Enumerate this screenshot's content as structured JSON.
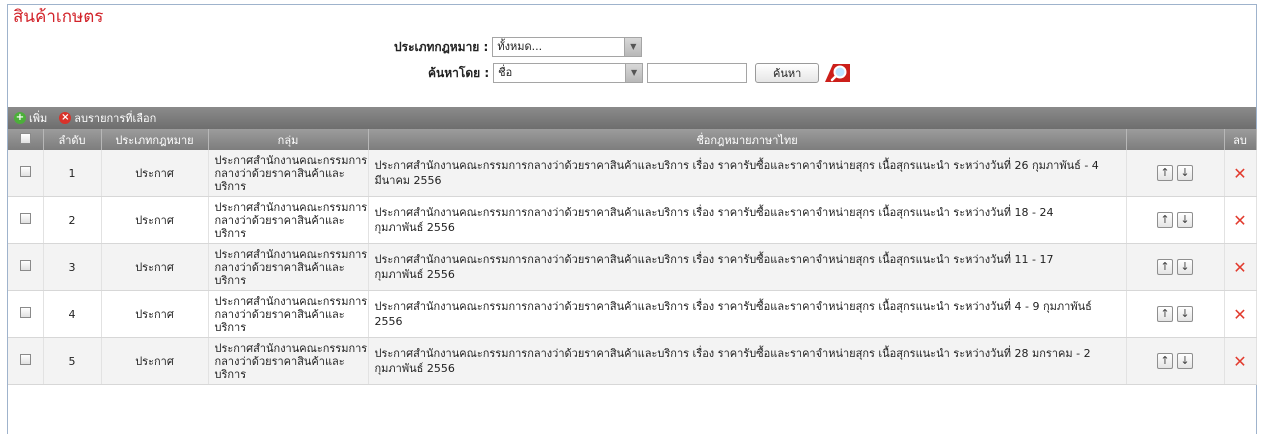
{
  "page": {
    "title": "สินค้าเกษตร"
  },
  "filters": {
    "law_type_label": "ประเภทกฎหมาย :",
    "law_type_value": "ทั้งหมด...",
    "search_by_label": "ค้นหาโดย :",
    "search_by_value": "ชื่อ",
    "search_text": "",
    "search_button": "ค้นหา"
  },
  "toolbar": {
    "add_label": "เพิ่ม",
    "delete_selected_label": "ลบรายการที่เลือก"
  },
  "table": {
    "headers": {
      "no": "ลำดับ",
      "type": "ประเภทกฎหมาย",
      "group": "กลุ่ม",
      "name": "ชื่อกฎหมายภาษาไทย",
      "order": "",
      "delete": "ลบ"
    },
    "rows": [
      {
        "no": "1",
        "type": "ประกาศ",
        "group": "ประกาศสำนักงานคณะกรรมการกลางว่าด้วยราคาสินค้าและบริการ",
        "name": "ประกาศสำนักงานคณะกรรมการกลางว่าด้วยราคาสินค้าและบริการ เรื่อง ราคารับซื้อและราคาจำหน่ายสุกร เนื้อสุกรแนะนำ ระหว่างวันที่ 26 กุมภาพันธ์ - 4 มีนาคม 2556"
      },
      {
        "no": "2",
        "type": "ประกาศ",
        "group": "ประกาศสำนักงานคณะกรรมการกลางว่าด้วยราคาสินค้าและบริการ",
        "name": "ประกาศสำนักงานคณะกรรมการกลางว่าด้วยราคาสินค้าและบริการ เรื่อง ราคารับซื้อและราคาจำหน่ายสุกร เนื้อสุกรแนะนำ ระหว่างวันที่ 18 - 24 กุมภาพันธ์ 2556"
      },
      {
        "no": "3",
        "type": "ประกาศ",
        "group": "ประกาศสำนักงานคณะกรรมการกลางว่าด้วยราคาสินค้าและบริการ",
        "name": "ประกาศสำนักงานคณะกรรมการกลางว่าด้วยราคาสินค้าและบริการ เรื่อง ราคารับซื้อและราคาจำหน่ายสุกร เนื้อสุกรแนะนำ ระหว่างวันที่ 11 - 17 กุมภาพันธ์ 2556"
      },
      {
        "no": "4",
        "type": "ประกาศ",
        "group": "ประกาศสำนักงานคณะกรรมการกลางว่าด้วยราคาสินค้าและบริการ",
        "name": "ประกาศสำนักงานคณะกรรมการกลางว่าด้วยราคาสินค้าและบริการ เรื่อง ราคารับซื้อและราคาจำหน่ายสุกร เนื้อสุกรแนะนำ ระหว่างวันที่ 4 - 9 กุมภาพันธ์ 2556"
      },
      {
        "no": "5",
        "type": "ประกาศ",
        "group": "ประกาศสำนักงานคณะกรรมการกลางว่าด้วยราคาสินค้าและบริการ",
        "name": "ประกาศสำนักงานคณะกรรมการกลางว่าด้วยราคาสินค้าและบริการ เรื่อง ราคารับซื้อและราคาจำหน่ายสุกร เนื้อสุกรแนะนำ ระหว่างวันที่ 28 มกราคม - 2 กุมภาพันธ์ 2556"
      }
    ],
    "move_up_icon": "arrow-up-icon",
    "move_down_icon": "arrow-down-icon",
    "delete_icon": "red-x-icon"
  },
  "colors": {
    "title": "#d2232a",
    "header_bg": "#8a8a8a",
    "delete_x": "#e23b2e",
    "add_icon": "#4caf3a"
  }
}
